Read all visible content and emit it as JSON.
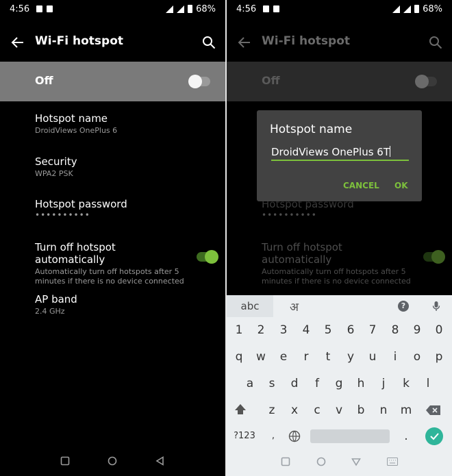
{
  "status_bar": {
    "time": "4:56",
    "battery": "68%"
  },
  "app_bar": {
    "title": "Wi-Fi hotspot",
    "back_icon": "arrow-left-icon",
    "search_icon": "search-icon"
  },
  "master_switch": {
    "label": "Off",
    "on": false
  },
  "settings": [
    {
      "title": "Hotspot name",
      "summary": "DroidViews OnePlus 6"
    },
    {
      "title": "Security",
      "summary": "WPA2 PSK"
    },
    {
      "title": "Hotspot password",
      "summary": "••••••••••"
    },
    {
      "title": "Turn off hotspot automatically",
      "summary": "Automatically turn off hotspots after 5 minutes if there is no device connected",
      "on": true
    },
    {
      "title": "AP band",
      "summary": "2.4 GHz"
    }
  ],
  "dialog": {
    "title": "Hotspot name",
    "value": "DroidViews OnePlus 6T",
    "cancel_label": "CANCEL",
    "ok_label": "OK"
  },
  "keyboard": {
    "tab_abc": "abc",
    "tab_hindi": "अ",
    "help": "?",
    "numbers": [
      "1",
      "2",
      "3",
      "4",
      "5",
      "6",
      "7",
      "8",
      "9",
      "0"
    ],
    "row1": [
      "q",
      "w",
      "e",
      "r",
      "t",
      "y",
      "u",
      "i",
      "o",
      "p"
    ],
    "row2": [
      "a",
      "s",
      "d",
      "f",
      "g",
      "h",
      "j",
      "k",
      "l"
    ],
    "row3": [
      "z",
      "x",
      "c",
      "v",
      "b",
      "n",
      "m"
    ],
    "symbols": "?123",
    "emoji_comma": ",",
    "period": "."
  },
  "colors": {
    "accent": "#7dc03c",
    "enter": "#2fb59a",
    "master_bg": "#7a7a7a"
  }
}
